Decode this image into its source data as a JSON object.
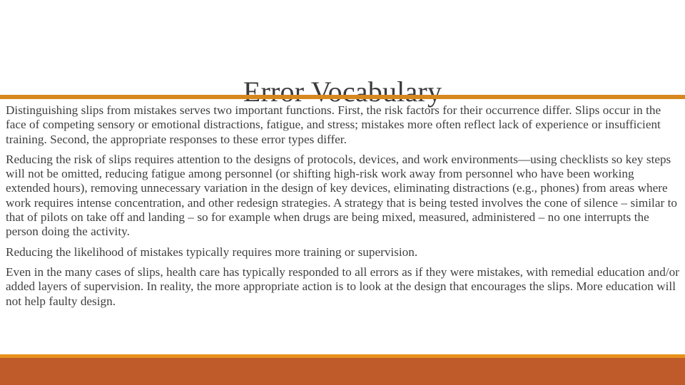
{
  "slide": {
    "title": "Error Vocabulary",
    "paragraphs": [
      "Distinguishing slips from mistakes serves two important functions. First, the risk factors for their occurrence differ. Slips occur in the face of competing sensory or emotional distractions, fatigue, and stress; mistakes more often reflect lack of experience or insufficient training. Second, the appropriate responses to these error types differ.",
      "Reducing the risk of slips requires attention to the designs of protocols, devices, and work environments—using checklists so key steps will not be omitted, reducing fatigue among personnel (or shifting high-risk work away from personnel who have been working extended hours), removing unnecessary variation in the design of key devices, eliminating distractions (e.g., phones) from areas where work requires intense concentration, and other redesign strategies. A strategy that is being tested involves the cone of silence – similar to that of pilots on take off and landing – so for example when drugs are being mixed, measured, administered – no one interrupts the person doing the activity.",
      "Reducing the likelihood of mistakes typically requires more training or supervision.",
      "Even in the many cases of slips, health care has typically responded to all errors as if they were mistakes, with remedial education and/or added layers of supervision. In reality, the more appropriate action is to look at the design that encourages the slips.  More education will not help faulty design."
    ],
    "colors": {
      "title_rule": "#d6881f",
      "bottom_accent": "#e8901b",
      "bottom_bar": "#bf5b2b",
      "title_text": "#3b3b3b",
      "body_text": "#3f3f3f",
      "background": "#ffffff"
    }
  }
}
